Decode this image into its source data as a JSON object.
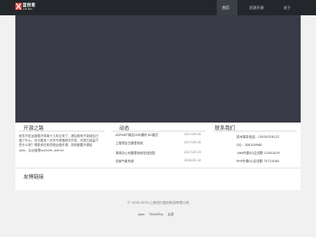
{
  "header": {
    "logo_name": "蓝创客",
    "logo_sub": "LCM BOX",
    "nav": [
      "首页",
      "资源开源",
      "关于"
    ],
    "active_index": 0
  },
  "about": {
    "title": "开源之路",
    "text": "软件开发运营路不简单十几年过来了，团队都来不如继自己做了什么。也可能有一天学不再做软件开发。可是又能留下些什么呢？想着来在软件做全做开源，特别都要开源给ipos，后台管理/wjinner_admin"
  },
  "news": {
    "title": "动态",
    "items": [
      {
        "text": "ASP.NET网站CMS源码 6C模式",
        "date": "2017-05-04"
      },
      {
        "text": "工程项目日报表系统",
        "date": "2017-05-04"
      },
      {
        "text": "简单办公司图表系统在线回答",
        "date": "2017-05-19"
      },
      {
        "text": "向家气象系统",
        "date": "2018-05-14"
      }
    ]
  },
  "contact": {
    "title": "联系我们",
    "items": [
      "技术事务电话：15034326112",
      "QQ：306109960",
      ".Net开源QQ交流群 13001009",
      "PHP开源QQ交流群 75729264"
    ]
  },
  "links": {
    "title": "友情链接"
  },
  "footer": {
    "copyright": "© 2016-2020 山西创行蓝创科技有限公司",
    "links": [
      "ipos",
      "ThinkPhp",
      "后茶"
    ]
  },
  "colors": {
    "topbar": "#23272b",
    "banner": "#383b47",
    "accent": "#e8443a"
  }
}
